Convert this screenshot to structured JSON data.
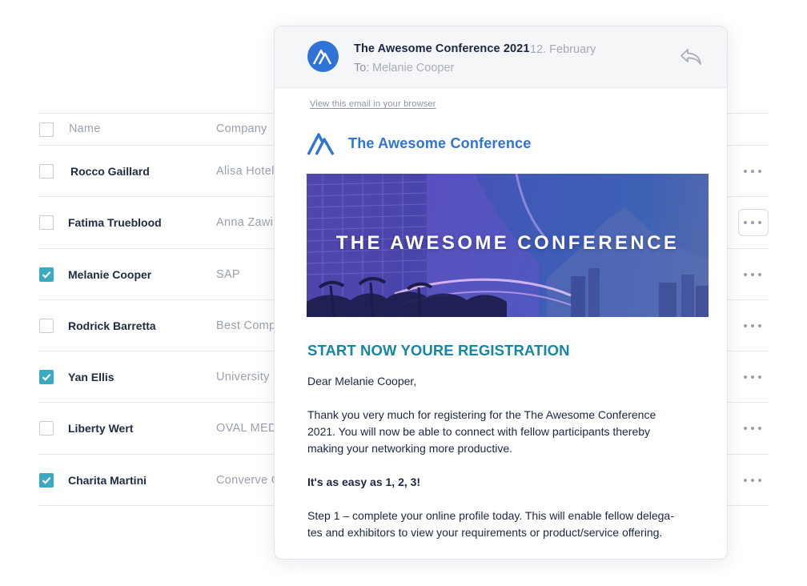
{
  "table": {
    "headers": {
      "name": "Name",
      "company": "Company"
    },
    "rows": [
      {
        "name": "Rocco Gaillard",
        "company": "Alisa Hotel",
        "checked": false
      },
      {
        "name": "Fatima Trueblood",
        "company": "Anna Zawi",
        "checked": false
      },
      {
        "name": "Melanie Cooper",
        "company": "SAP",
        "checked": true
      },
      {
        "name": "Rodrick Barretta",
        "company": "Best Comp",
        "checked": false
      },
      {
        "name": "Yan Ellis",
        "company": "University",
        "checked": true
      },
      {
        "name": "Liberty Wert",
        "company": "OVAL MED",
        "checked": false
      },
      {
        "name": "Charita Martini",
        "company": "Converve G",
        "checked": true
      }
    ]
  },
  "email": {
    "subject": "The Awesome Conference 2021",
    "date": "12. February",
    "to_label": "To:",
    "to_value": "Melanie Cooper",
    "view_link": "View this email in your browser",
    "brand_name": "The Awesome Conference",
    "banner_title": "THE AWESOME CONFERENCE",
    "heading": "START NOW YOURE REGISTRATION",
    "greeting": "Dear Melanie Cooper,",
    "paragraph1_line1": "Thank you very much for registering for the The Awesome Conference",
    "paragraph1_line2": "2021. You will now be able to connect with fellow participants thereby",
    "paragraph1_line3": "making your networking more productive.",
    "easy": "It's as easy as 1, 2, 3!",
    "step1_line1": "Step 1 – complete your online profile today. This will enable fellow delega-",
    "step1_line2": "tes and exhibitors to view your requirements or product/service offering."
  },
  "colors": {
    "brand_blue": "#2f73d6",
    "teal_heading": "#1587a2",
    "checkbox_checked": "#3aaac4"
  },
  "icons": [
    "checkbox-icon",
    "more-options-icon",
    "logo-icon",
    "reply-icon"
  ]
}
